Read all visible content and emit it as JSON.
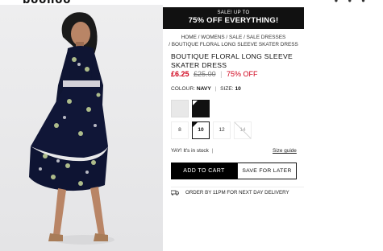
{
  "header": {
    "logo": "boohoo",
    "icons": [
      "search-icon",
      "account-icon",
      "bag-icon"
    ]
  },
  "promo": {
    "small": "SALE! UP TO",
    "big": "75% OFF EVERYTHING!"
  },
  "breadcrumb": {
    "line1": "HOME / WOMENS / SALE / SALE DRESSES",
    "line2": "/ BOUTIQUE FLORAL LONG SLEEVE SKATER DRESS"
  },
  "product": {
    "title": "BOUTIQUE FLORAL LONG SLEEVE SKATER DRESS",
    "price_now": "£6.25",
    "price_was": "£25.00",
    "price_sep": "|",
    "discount": "75% OFF",
    "colour_label": "COLOUR:",
    "colour_value": "NAVY",
    "size_label": "SIZE:",
    "size_value": "10",
    "colors": [
      "#e8e8e8",
      "#111111"
    ],
    "sizes": [
      "8",
      "10",
      "12",
      "14"
    ],
    "stock_text": "YAY! It's in stock",
    "size_guide": "Size guide",
    "add_to_cart": "ADD TO CART",
    "save_for_later": "SAVE FOR LATER",
    "delivery_text": "ORDER BY 11PM FOR NEXT DAY DELIVERY"
  },
  "theme": {
    "accent": "#d0021b",
    "primary": "#000000",
    "banner_bg": "#111111"
  }
}
